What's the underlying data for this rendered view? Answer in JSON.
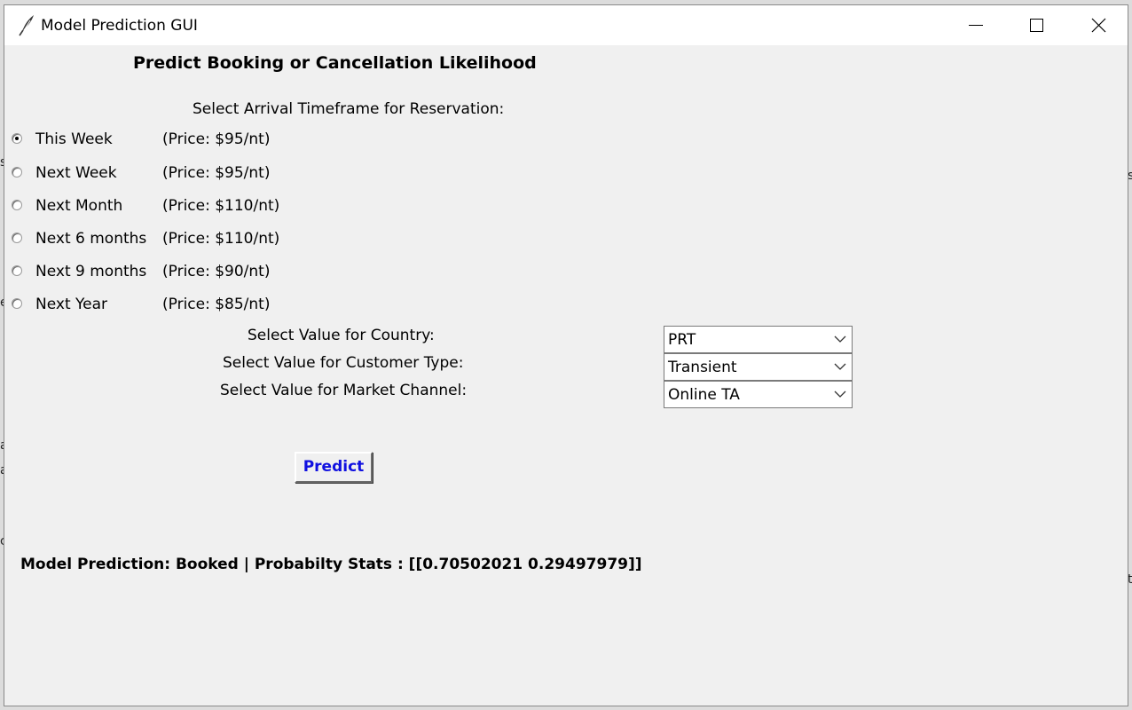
{
  "window": {
    "title": "Model Prediction GUI",
    "controls": [
      "minimize-icon",
      "maximize-icon",
      "close-icon"
    ]
  },
  "main": {
    "heading": "Predict Booking or Cancellation Likelihood",
    "timeframe_prompt": "Select Arrival Timeframe for Reservation:",
    "timeframe_options": [
      {
        "label": "This Week",
        "price": "(Price: $95/nt)",
        "selected": true
      },
      {
        "label": "Next Week",
        "price": "(Price: $95/nt)",
        "selected": false
      },
      {
        "label": "Next Month",
        "price": "(Price: $110/nt)",
        "selected": false
      },
      {
        "label": "Next 6 months",
        "price": "(Price: $110/nt)",
        "selected": false
      },
      {
        "label": "Next 9 months",
        "price": "(Price: $90/nt)",
        "selected": false
      },
      {
        "label": "Next Year",
        "price": "(Price: $85/nt)",
        "selected": false
      }
    ],
    "country": {
      "label": "Select Value for Country:",
      "value": "PRT"
    },
    "customer_type": {
      "label": "Select Value for Customer Type:",
      "value": "Transient"
    },
    "market_channel": {
      "label": "Select Value for Market Channel:",
      "value": "Online TA"
    },
    "predict_label": "Predict",
    "result_text": "Model Prediction: Booked | Probabilty Stats : [[0.70502021 0.29497979]]"
  },
  "colors": {
    "window_bg": "#f0f0f0",
    "titlebar_bg": "#ffffff",
    "predict_text": "#1010e0"
  }
}
